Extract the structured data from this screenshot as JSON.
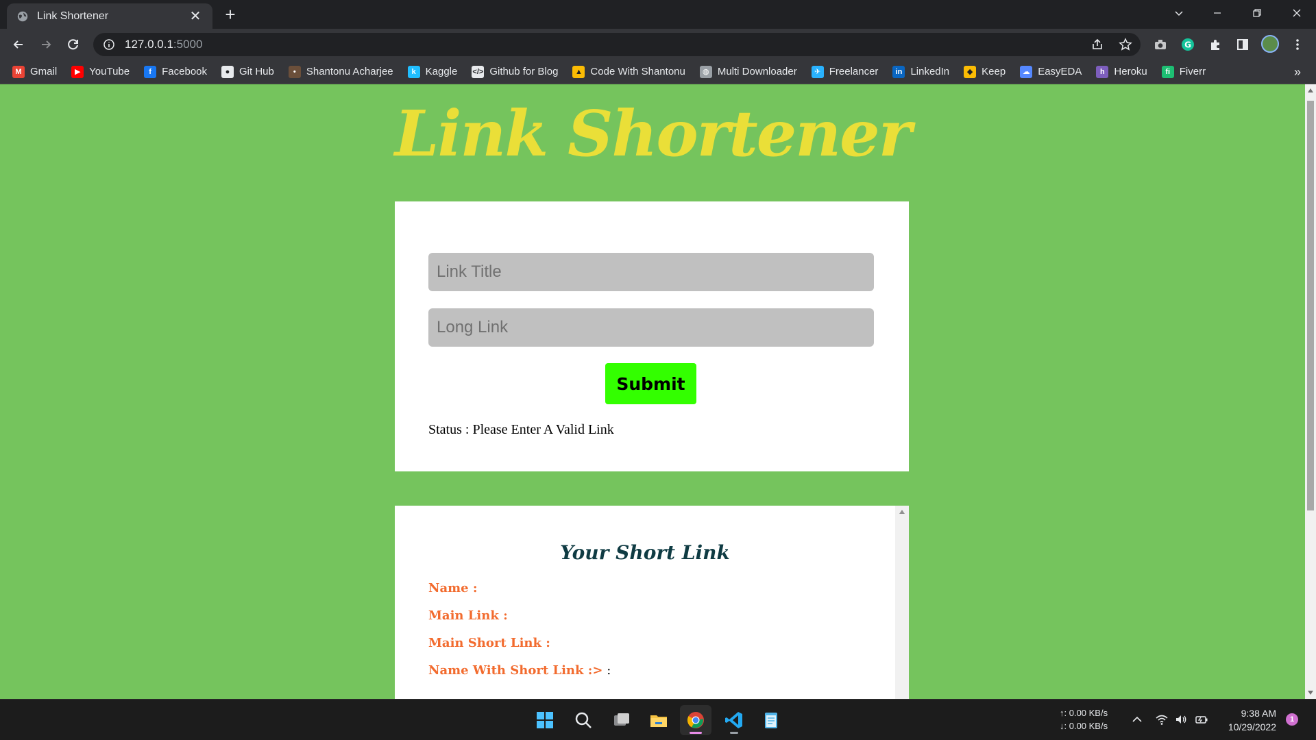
{
  "browser": {
    "tab_title": "Link Shortener",
    "tab_close": "✕",
    "new_tab": "+",
    "url_host": "127.0.0.1",
    "url_port": ":5000"
  },
  "bookmarks": [
    {
      "label": "Gmail",
      "icon": "gmail-icon",
      "color": "#ea4335",
      "glyph": "M"
    },
    {
      "label": "YouTube",
      "icon": "youtube-icon",
      "color": "#ff0000",
      "glyph": "▶"
    },
    {
      "label": "Facebook",
      "icon": "facebook-icon",
      "color": "#1877f2",
      "glyph": "f"
    },
    {
      "label": "Git Hub",
      "icon": "github-icon",
      "color": "#e8eaed",
      "glyph": "●"
    },
    {
      "label": "Shantonu Acharjee",
      "icon": "profile-icon",
      "color": "#6b4f3a",
      "glyph": "•"
    },
    {
      "label": "Kaggle",
      "icon": "kaggle-icon",
      "color": "#20beff",
      "glyph": "k"
    },
    {
      "label": "Github for Blog",
      "icon": "code-icon",
      "color": "#e8eaed",
      "glyph": "</>"
    },
    {
      "label": "Code With Shantonu",
      "icon": "drive-icon",
      "color": "#fbbc04",
      "glyph": "▲"
    },
    {
      "label": "Multi Downloader",
      "icon": "globe-icon",
      "color": "#9aa0a6",
      "glyph": "◍"
    },
    {
      "label": "Freelancer",
      "icon": "freelancer-icon",
      "color": "#29b2fe",
      "glyph": "✈"
    },
    {
      "label": "LinkedIn",
      "icon": "linkedin-icon",
      "color": "#0a66c2",
      "glyph": "in"
    },
    {
      "label": "Keep",
      "icon": "keep-icon",
      "color": "#fbbc04",
      "glyph": "◆"
    },
    {
      "label": "EasyEDA",
      "icon": "easyeda-icon",
      "color": "#5588ff",
      "glyph": "☁"
    },
    {
      "label": "Heroku",
      "icon": "heroku-icon",
      "color": "#7d5ebd",
      "glyph": "h"
    },
    {
      "label": "Fiverr",
      "icon": "fiverr-icon",
      "color": "#1dbf73",
      "glyph": "fi"
    }
  ],
  "bookmarks_more": "»",
  "page": {
    "heading": "Link Shortener",
    "form": {
      "title_placeholder": "Link Title",
      "link_placeholder": "Long Link",
      "submit_label": "Submit",
      "status_text": "Status : Please Enter A Valid Link"
    },
    "result": {
      "heading": "Your Short Link",
      "name_label": "Name :",
      "main_link_label": "Main Link :",
      "main_short_link_label": "Main Short Link :",
      "name_with_short_link_label": "Name With Short Link :>",
      "name_with_short_link_value": " :"
    }
  },
  "taskbar": {
    "net_up": "↑: 0.00 KB/s",
    "net_down": "↓: 0.00 KB/s",
    "time": "9:38 AM",
    "date": "10/29/2022",
    "notification_count": "1"
  },
  "colors": {
    "page_background": "#75c45d",
    "heading": "#eadf38",
    "submit_button": "#33ff00",
    "result_labels": "#f26b2e",
    "result_heading": "#0f3b43"
  }
}
